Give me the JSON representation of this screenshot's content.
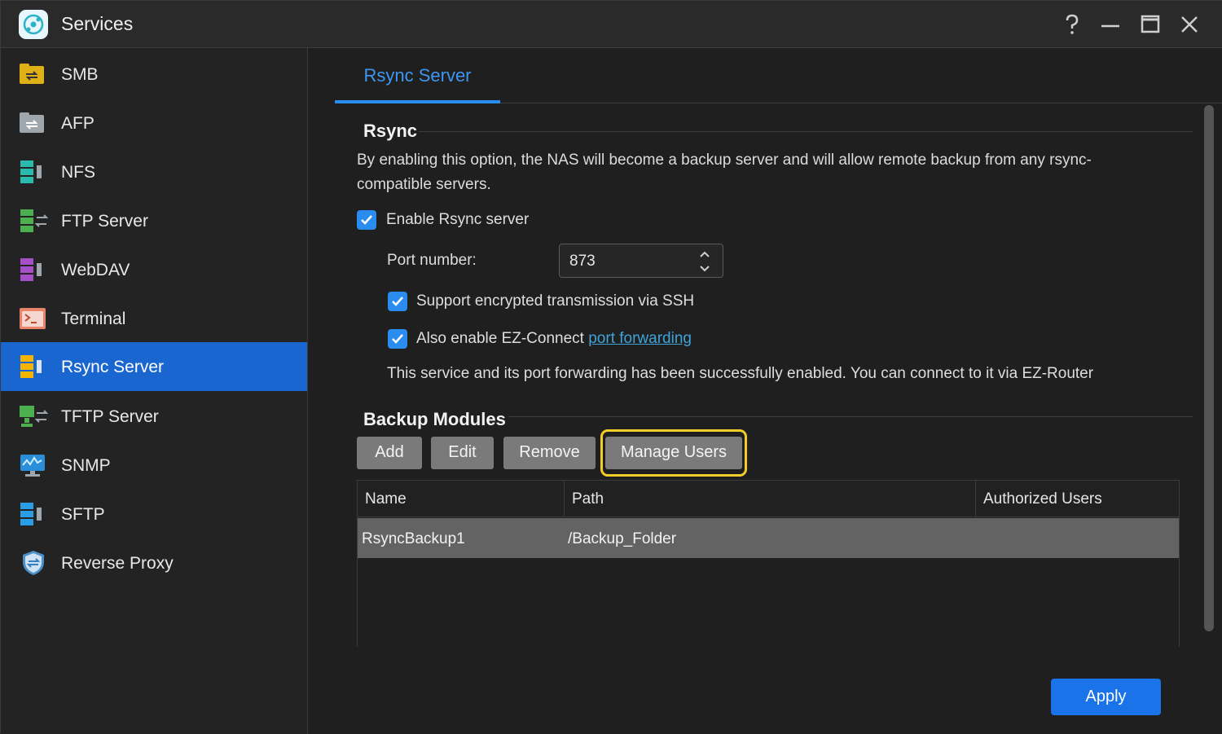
{
  "window": {
    "title": "Services"
  },
  "sidebar": {
    "items": [
      {
        "label": "SMB",
        "icon": "smb-folder-icon"
      },
      {
        "label": "AFP",
        "icon": "afp-folder-icon"
      },
      {
        "label": "NFS",
        "icon": "nfs-server-icon"
      },
      {
        "label": "FTP Server",
        "icon": "ftp-server-icon"
      },
      {
        "label": "WebDAV",
        "icon": "webdav-server-icon"
      },
      {
        "label": "Terminal",
        "icon": "terminal-icon"
      },
      {
        "label": "Rsync Server",
        "icon": "rsync-server-icon",
        "active": true
      },
      {
        "label": "TFTP Server",
        "icon": "tftp-server-icon"
      },
      {
        "label": "SNMP",
        "icon": "snmp-monitor-icon"
      },
      {
        "label": "SFTP",
        "icon": "sftp-server-icon"
      },
      {
        "label": "Reverse Proxy",
        "icon": "shield-icon"
      }
    ]
  },
  "tabs": [
    {
      "label": "Rsync Server",
      "active": true
    }
  ],
  "rsync": {
    "title": "Rsync",
    "description": "By enabling this option, the NAS will become a backup server and will allow remote backup from any rsync-compatible servers.",
    "enable_label": "Enable Rsync server",
    "enable_checked": true,
    "port_label": "Port number:",
    "port_value": "873",
    "ssh_label": "Support encrypted transmission via SSH",
    "ssh_checked": true,
    "ezconnect_prefix": "Also enable EZ-Connect ",
    "ezconnect_link": "port forwarding",
    "ezconnect_checked": true,
    "status_text": "This service and its port forwarding has been successfully enabled. You can connect to it via EZ-Router"
  },
  "backup_modules": {
    "title": "Backup Modules",
    "buttons": {
      "add": "Add",
      "edit": "Edit",
      "remove": "Remove",
      "manage_users": "Manage Users"
    },
    "columns": [
      "Name",
      "Path",
      "Authorized Users"
    ],
    "rows": [
      {
        "name": "RsyncBackup1",
        "path": "/Backup_Folder",
        "authorized_users": ""
      }
    ]
  },
  "footer": {
    "apply_label": "Apply"
  },
  "colors": {
    "accent": "#1a73e8",
    "highlight": "#f2cc2b",
    "tab": "#3d97f2"
  }
}
